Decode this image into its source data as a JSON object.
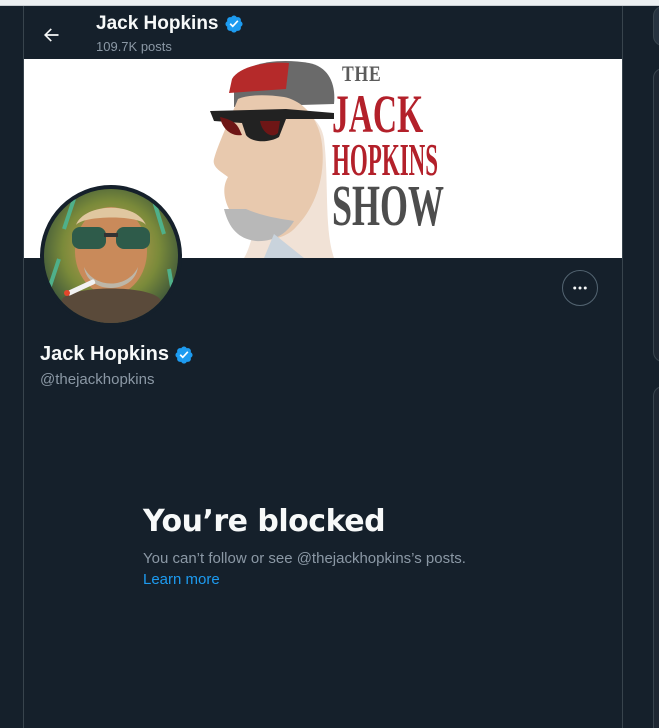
{
  "header": {
    "name": "Jack Hopkins",
    "posts_count": "109.7K posts"
  },
  "banner": {
    "line1": "THE",
    "line2": "JACK",
    "line3": "HOPKINS",
    "line4": "SHOW"
  },
  "profile": {
    "name": "Jack Hopkins",
    "handle": "@thejackhopkins",
    "verified": true
  },
  "blocked": {
    "title": "You’re blocked",
    "message": "You can’t follow or see @thejackhopkins’s posts.",
    "link": "Learn more"
  },
  "colors": {
    "background": "#15202b",
    "accent": "#1d9bf0",
    "secondary_text": "#8b98a5",
    "banner_red": "#b3202a"
  },
  "icons": {
    "back": "arrow-left-icon",
    "verified": "verified-badge-icon",
    "more": "more-horizontal-icon"
  }
}
